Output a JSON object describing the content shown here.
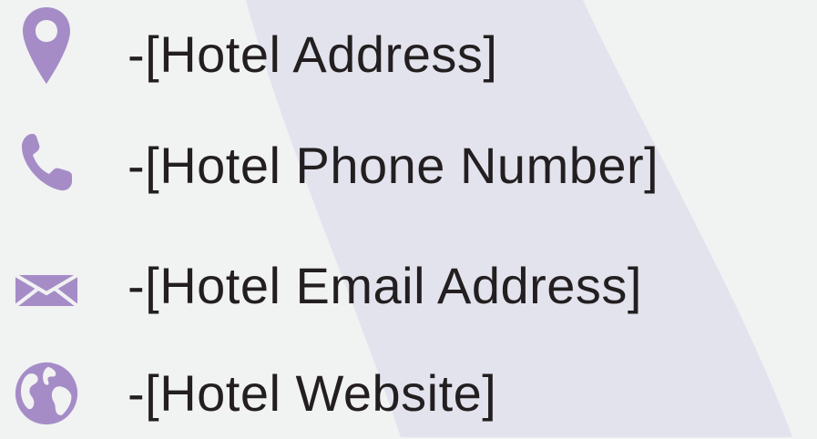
{
  "colors": {
    "background": "#f1f2f2",
    "band": "#e3e3ee",
    "icon": "#a58cc7",
    "text": "#231f20"
  },
  "contacts": [
    {
      "icon": "map-pin-icon",
      "label": "-[Hotel Address]"
    },
    {
      "icon": "phone-icon",
      "label": "-[Hotel Phone Number]"
    },
    {
      "icon": "envelope-icon",
      "label": "-[Hotel Email Address]"
    },
    {
      "icon": "globe-icon",
      "label": "-[Hotel Website]"
    }
  ]
}
